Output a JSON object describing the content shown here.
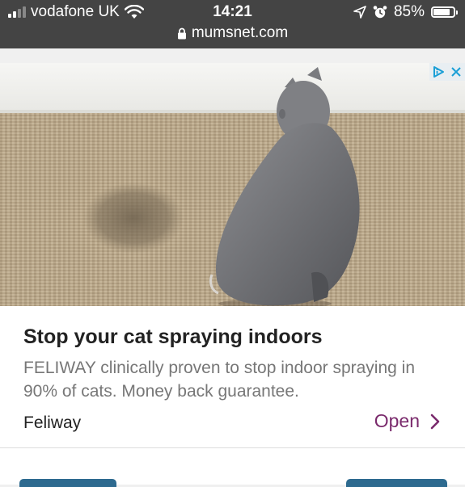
{
  "status_bar": {
    "carrier": "vodafone UK",
    "time": "14:21",
    "battery": "85%",
    "battery_level": 0.85,
    "url": "mumsnet.com"
  },
  "ad": {
    "title": "Stop your cat spraying indoors",
    "description": "FELIWAY clinically proven to stop indoor spraying in 90% of cats. Money back guarantee.",
    "advertiser": "Feliway",
    "cta_label": "Open",
    "accent_color": "#7a2a6c",
    "adchoices_color": "#1a9fd6"
  }
}
